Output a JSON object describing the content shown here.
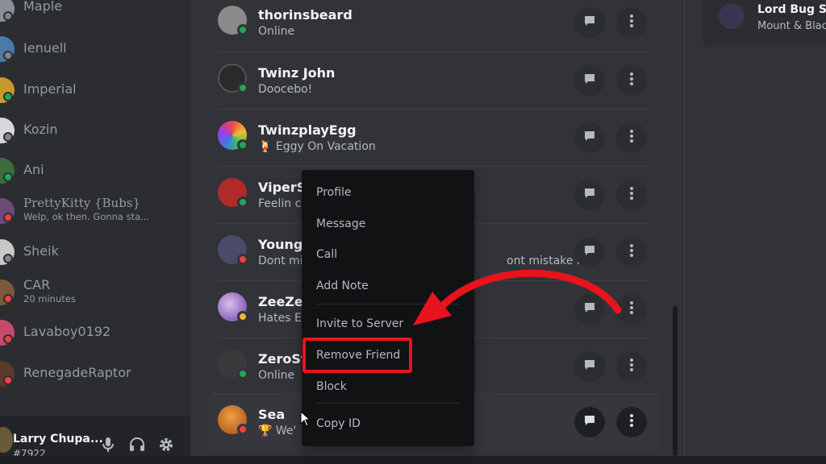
{
  "sidebar": {
    "dms": [
      {
        "name": "Maple",
        "sub": "",
        "status": "offline",
        "color": "#8a8f98"
      },
      {
        "name": "Ienuell",
        "sub": "",
        "status": "offline",
        "color": "#4a7aa8"
      },
      {
        "name": "Imperial",
        "sub": "",
        "status": "online",
        "color": "#c79a2e"
      },
      {
        "name": "Kozin",
        "sub": "",
        "status": "offline",
        "color": "#d8d8d8"
      },
      {
        "name": "Ani",
        "sub": "",
        "status": "online",
        "color": "#3c6b3e"
      },
      {
        "name": "PrettyKitty {Bubs}",
        "sub": "Welp, ok then. Gonna sta...",
        "status": "dnd",
        "color": "#6c4a7a"
      },
      {
        "name": "Sheik",
        "sub": "",
        "status": "offline",
        "color": "#c8c8c8"
      },
      {
        "name": "CAR",
        "sub": "20 minutes",
        "status": "dnd",
        "color": "#7a5a3a"
      },
      {
        "name": "Lavaboy0192",
        "sub": "",
        "status": "dnd",
        "color": "#c84a6a"
      },
      {
        "name": "RenegadeRaptor",
        "sub": "",
        "status": "dnd",
        "color": "#5a3a2a"
      }
    ],
    "user": {
      "name": "Larry Chupa...",
      "tag": "#7922"
    }
  },
  "friends": [
    {
      "name": "thorinsbeard",
      "sub": "Online",
      "status": "online",
      "color": "#8a8a8a"
    },
    {
      "name": "Twinz John",
      "sub": "Doocebo!",
      "status": "online",
      "color": "#2a2a2a"
    },
    {
      "name": "TwinzplayEgg",
      "sub": "Eggy On Vacation",
      "sub_emoji": "🍹",
      "status": "online",
      "color": "#9a3a8a"
    },
    {
      "name": "ViperS",
      "sub": "Feelin c",
      "status": "online",
      "color": "#b02a2a"
    },
    {
      "name": "Young",
      "sub": "Dont mi",
      "sub_tail": "ont mistake m...",
      "status": "dnd",
      "color": "#4a4a6a"
    },
    {
      "name": "ZeeZe",
      "sub": "Hates E",
      "status": "idle",
      "color": "#6a3aa0"
    },
    {
      "name": "ZeroSt",
      "sub": "Online",
      "status": "online",
      "color": "#3a3a3a"
    },
    {
      "name": "Sea",
      "sub": "We'",
      "sub_emoji": "🏆",
      "status": "dnd",
      "color": "#c06a2a"
    }
  ],
  "active_now": {
    "name": "Lord Bug Sp",
    "sub": "Mount & Blac"
  },
  "context_menu": {
    "items": [
      "Profile",
      "Message",
      "Call",
      "Add Note",
      "Invite to Server",
      "Remove Friend",
      "Block",
      "Copy ID"
    ]
  },
  "colors": {
    "highlight": "#e8131c",
    "online": "#23a55a",
    "dnd": "#f23f43",
    "idle": "#f0b232"
  }
}
